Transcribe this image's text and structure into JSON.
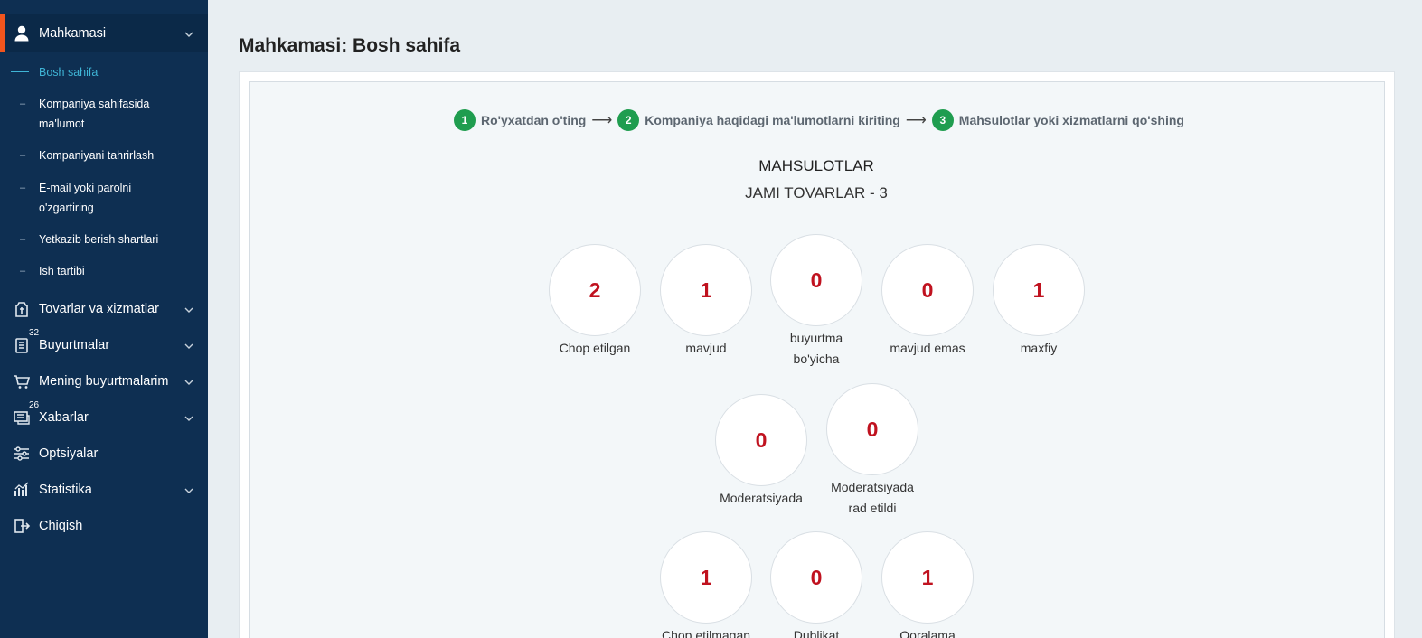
{
  "sidebar": {
    "header": {
      "label": "Mahkamasi",
      "icon": "user-icon"
    },
    "subitems": [
      {
        "label": "Bosh sahifa",
        "active": true
      },
      {
        "label": "Kompaniya sahifasida ma'lumot"
      },
      {
        "label": "Kompaniyani tahrirlash"
      },
      {
        "label": "E-mail yoki parolni o'zgartiring"
      },
      {
        "label": "Yetkazib berish shartlari"
      },
      {
        "label": "Ish tartibi"
      }
    ],
    "items": [
      {
        "label": "Tovarlar va xizmatlar",
        "icon": "product-tag-icon",
        "chevron": true
      },
      {
        "label": "Buyurtmalar",
        "icon": "orders-list-icon",
        "badge": "32",
        "chevron": true
      },
      {
        "label": "Mening buyurtmalarim",
        "icon": "cart-icon",
        "chevron": true
      },
      {
        "label": "Xabarlar",
        "icon": "messages-icon",
        "badge": "26",
        "chevron": true
      },
      {
        "label": "Optsiyalar",
        "icon": "sliders-icon",
        "chevron": false
      },
      {
        "label": "Statistika",
        "icon": "chart-icon",
        "chevron": true
      },
      {
        "label": "Chiqish",
        "icon": "logout-icon",
        "chevron": false
      }
    ]
  },
  "main": {
    "title": "Mahkamasi: Bosh sahifa",
    "steps": [
      {
        "num": "1",
        "label": "Ro'yxatdan o'ting"
      },
      {
        "num": "2",
        "label": "Kompaniya haqidagi ma'lumotlarni kiriting"
      },
      {
        "num": "3",
        "label": "Mahsulotlar yoki xizmatlarni qo'shing"
      }
    ],
    "step_arrow": "⟶",
    "section_title": "MAHSULOTLAR",
    "section_subtitle": "JAMI TOVARLAR - 3",
    "stats": [
      {
        "value": "2",
        "label": "Chop etilgan"
      },
      {
        "value": "1",
        "label": "mavjud"
      },
      {
        "value": "0",
        "label": "buyurtma bo'yicha"
      },
      {
        "value": "0",
        "label": "mavjud emas"
      },
      {
        "value": "1",
        "label": "maxfiy"
      },
      {
        "value": "0",
        "label": "Moderatsiyada"
      },
      {
        "value": "0",
        "label": "Moderatsiyada rad etildi"
      },
      {
        "value": "1",
        "label": "Chop etilmagan"
      },
      {
        "value": "0",
        "label": "Dublikat"
      },
      {
        "value": "1",
        "label": "Qoralama"
      }
    ]
  },
  "colors": {
    "sidebar": "#0e2f52",
    "accent": "#f2551d",
    "active_link": "#3fb5d6",
    "step_green": "#1f9d4f",
    "stat_value": "#c0121f"
  }
}
